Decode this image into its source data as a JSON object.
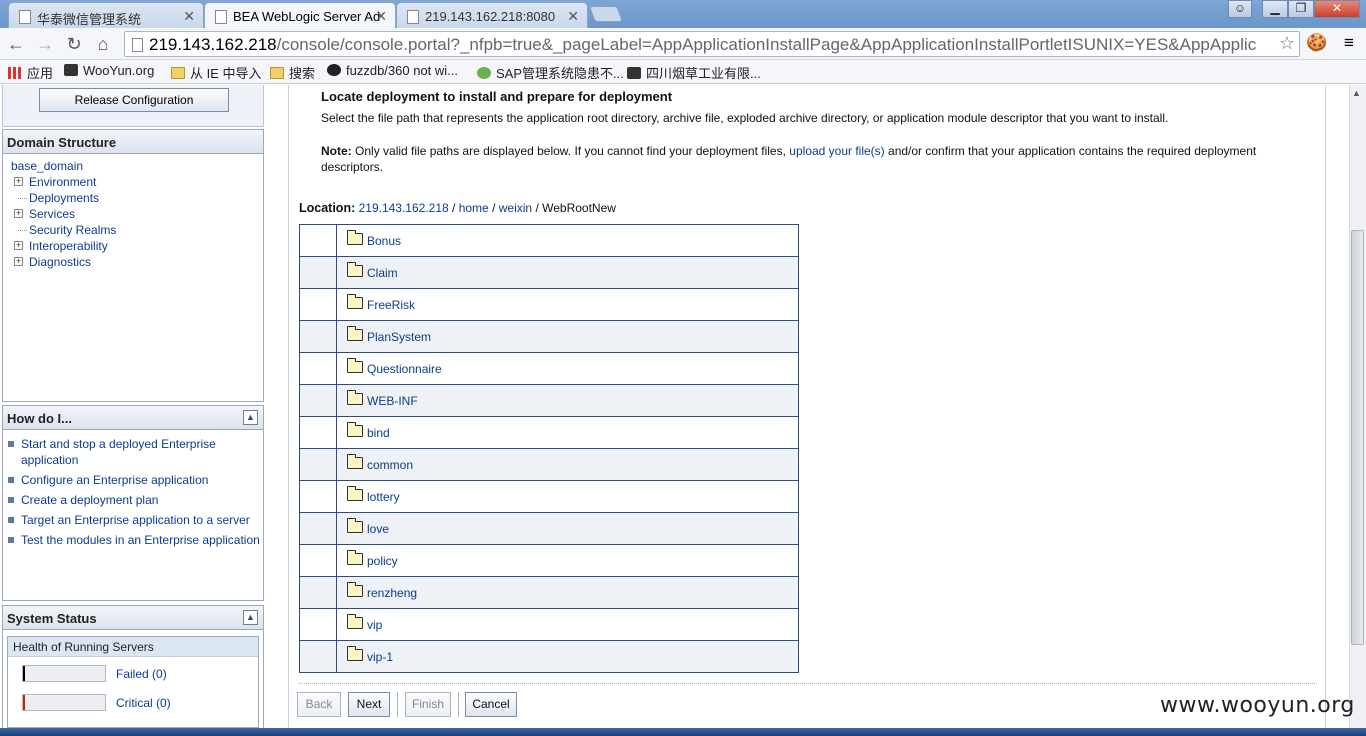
{
  "browser": {
    "tabs": [
      {
        "label": "华泰微信管理系统"
      },
      {
        "label": "BEA WebLogic Server Ad"
      },
      {
        "label": "219.143.162.218:8080"
      }
    ],
    "url_host": "219.143.162.218",
    "url_path": "/console/console.portal?_nfpb=true&_pageLabel=AppApplicationInstallPage&AppApplicationInstallPortletISUNIX=YES&AppApplic",
    "bookmarks": [
      {
        "label": "应用",
        "icon": "apps-icon"
      },
      {
        "label": "WooYun.org",
        "icon": "wooyun-icon"
      },
      {
        "label": "从 IE 中导入",
        "icon": "folder-icon"
      },
      {
        "label": "搜索",
        "icon": "folder-icon"
      },
      {
        "label": "fuzzdb/360 not wi...",
        "icon": "github-icon"
      },
      {
        "label": "SAP管理系统隐患不...",
        "icon": "check-icon"
      },
      {
        "label": "四川烟草工业有限...",
        "icon": "site-icon"
      }
    ]
  },
  "sidebar": {
    "release_button": "Release Configuration",
    "domain_structure": {
      "title": "Domain Structure",
      "root": "base_domain",
      "items": [
        "Environment",
        "Deployments",
        "Services",
        "Security Realms",
        "Interoperability",
        "Diagnostics"
      ]
    },
    "how_do_i": {
      "title": "How do I...",
      "items": [
        "Start and stop a deployed Enterprise application",
        "Configure an Enterprise application",
        "Create a deployment plan",
        "Target an Enterprise application to a server",
        "Test the modules in an Enterprise application"
      ]
    },
    "system_status": {
      "title": "System Status",
      "health_title": "Health of Running Servers",
      "rows": [
        {
          "label": "Failed (0)",
          "color": "#000000"
        },
        {
          "label": "Critical (0)",
          "color": "#cc2200"
        }
      ]
    }
  },
  "main": {
    "title": "Locate deployment to install and prepare for deployment",
    "description": "Select the file path that represents the application root directory, archive file, exploded archive directory, or application module descriptor that you want to install.",
    "note_label": "Note:",
    "note_pre": "Only valid file paths are displayed below. If you cannot find your deployment files,",
    "note_link": "upload your file(s)",
    "note_post": "and/or confirm that your application contains the required deployment descriptors.",
    "location_label": "Location:",
    "location_parts": [
      "219.143.162.218",
      "home",
      "weixin"
    ],
    "location_current": "WebRootNew",
    "folders": [
      "Bonus",
      "Claim",
      "FreeRisk",
      "PlanSystem",
      "Questionnaire",
      "WEB-INF",
      "bind",
      "common",
      "lottery",
      "love",
      "policy",
      "renzheng",
      "vip",
      "vip-1"
    ],
    "buttons": {
      "back": "Back",
      "next": "Next",
      "finish": "Finish",
      "cancel": "Cancel"
    }
  },
  "watermark": "www.wooyun.org",
  "colors": {
    "link": "#0b3c91",
    "panel_header": "#dce3ec",
    "tab_bar": "#6b96c9"
  }
}
